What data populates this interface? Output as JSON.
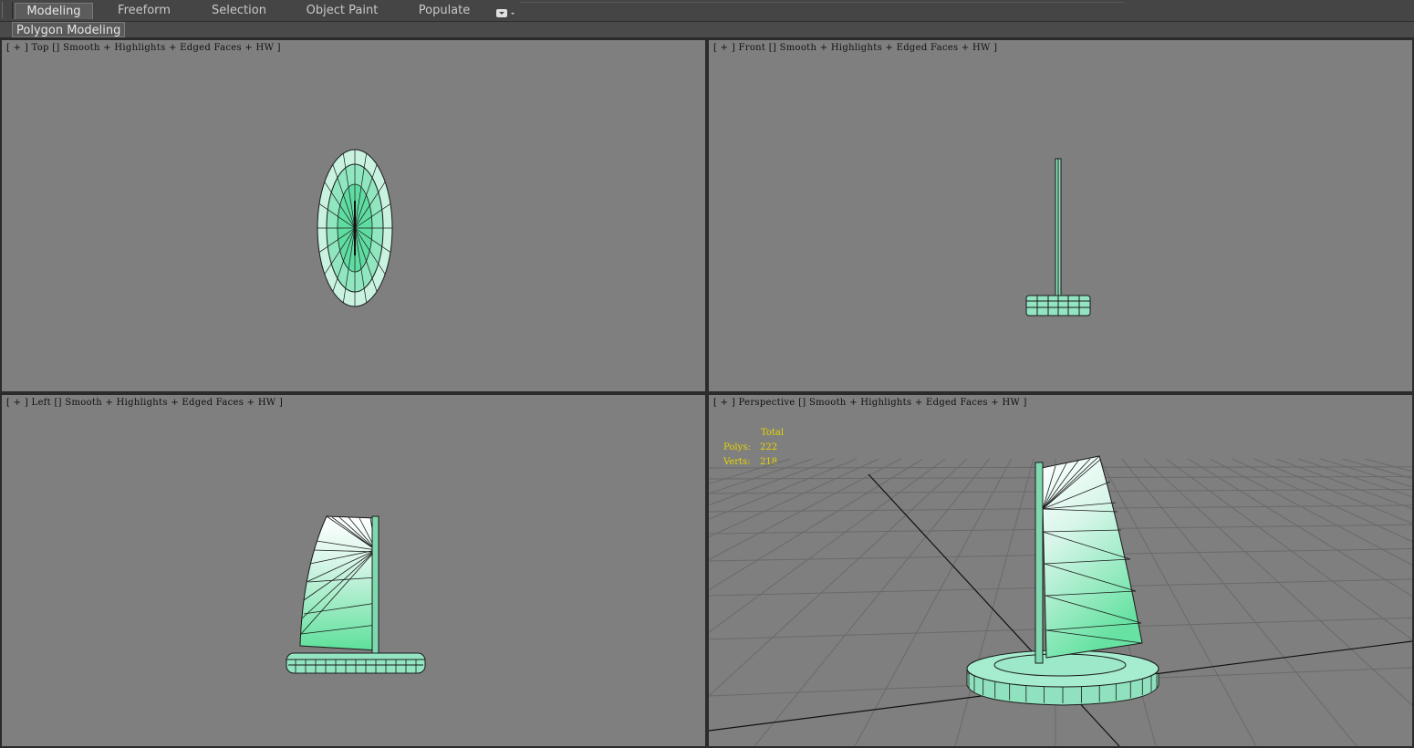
{
  "ribbon": {
    "tabs": [
      {
        "label": "Modeling",
        "active": true
      },
      {
        "label": "Freeform",
        "active": false
      },
      {
        "label": "Selection",
        "active": false
      },
      {
        "label": "Object Paint",
        "active": false
      },
      {
        "label": "Populate",
        "active": false
      }
    ],
    "dropdown_icon": "toggle-dropdown-icon"
  },
  "subbar": {
    "label": "Polygon Modeling"
  },
  "viewports": {
    "top": {
      "label": "[ + ] Top [] Smooth + Highlights + Edged Faces + HW ]"
    },
    "front": {
      "label": "[ + ] Front [] Smooth + Highlights + Edged Faces + HW ]"
    },
    "left": {
      "label": "[ + ] Left [] Smooth + Highlights + Edged Faces + HW ]"
    },
    "perspective": {
      "label": "[ + ] Perspective [] Smooth + Highlights + Edged Faces + HW ]"
    }
  },
  "stats": {
    "total_label": "Total",
    "polys_label": "Polys:",
    "polys_value": "222",
    "verts_label": "Verts:",
    "verts_value": "218"
  },
  "colors": {
    "viewport_bg": "#7f7f7f",
    "model_green": "#8fe8c0",
    "stats_yellow": "#e6d400"
  }
}
